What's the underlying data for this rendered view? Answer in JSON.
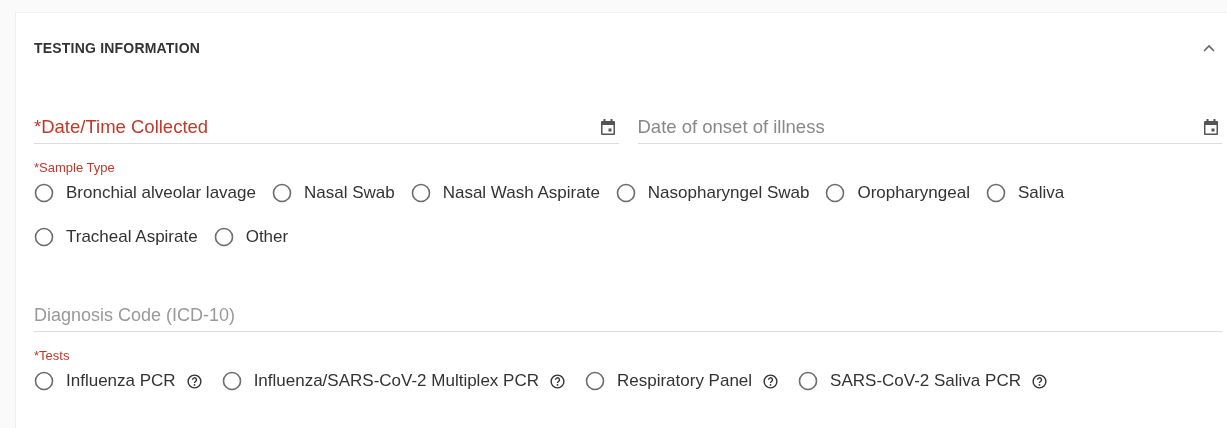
{
  "section": {
    "title": "TESTING INFORMATION",
    "expanded": true
  },
  "date_fields": [
    {
      "label": "*Date/Time Collected",
      "required": true
    },
    {
      "label": "Date of onset of illness",
      "required": false
    }
  ],
  "sample_type": {
    "label": "*Sample Type",
    "required": true,
    "options": [
      {
        "label": "Bronchial alveolar lavage",
        "selected": false
      },
      {
        "label": "Nasal Swab",
        "selected": false
      },
      {
        "label": "Nasal Wash Aspirate",
        "selected": false
      },
      {
        "label": "Nasopharyngel Swab",
        "selected": false
      },
      {
        "label": "Oropharyngeal",
        "selected": false
      },
      {
        "label": "Saliva",
        "selected": false
      },
      {
        "label": "Tracheal Aspirate",
        "selected": false
      },
      {
        "label": "Other",
        "selected": false
      }
    ]
  },
  "diagnosis_field": {
    "placeholder": "Diagnosis Code (ICD-10)"
  },
  "tests": {
    "label": "*Tests",
    "required": true,
    "options": [
      {
        "label": "Influenza PCR",
        "selected": false,
        "help": true
      },
      {
        "label": "Influenza/SARS-CoV-2 Multiplex PCR",
        "selected": false,
        "help": true
      },
      {
        "label": "Respiratory Panel",
        "selected": false,
        "help": true
      },
      {
        "label": "SARS-CoV-2 Saliva PCR",
        "selected": false,
        "help": true
      }
    ]
  }
}
